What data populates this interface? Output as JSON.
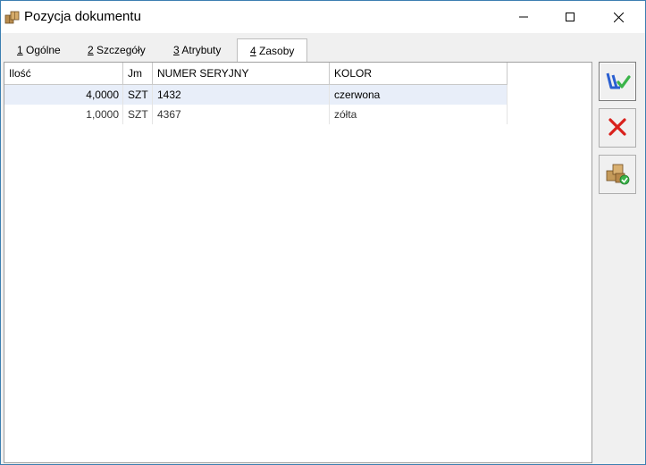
{
  "window": {
    "title": "Pozycja dokumentu"
  },
  "tabs": [
    {
      "key": "1",
      "label": " Ogólne"
    },
    {
      "key": "2",
      "label": " Szczegóły"
    },
    {
      "key": "3",
      "label": " Atrybuty"
    },
    {
      "key": "4",
      "label": " Zasoby"
    }
  ],
  "grid": {
    "columns": [
      "Ilość",
      "Jm",
      "NUMER SERYJNY",
      "KOLOR"
    ],
    "rows": [
      {
        "qty": "4,0000",
        "unit": "SZT",
        "serial": "1432",
        "color": "czerwona"
      },
      {
        "qty": "1,0000",
        "unit": "SZT",
        "serial": "4367",
        "color": "zółta"
      }
    ]
  },
  "icons": {
    "app": "package-icon",
    "save": "save-icon",
    "cancel": "cancel-x-icon",
    "resources": "resources-icon"
  },
  "colors": {
    "selected_row": "#e8eef9",
    "cancel_red": "#d9211c",
    "save_blue": "#2a5fd1",
    "save_check": "#3bb44a"
  }
}
